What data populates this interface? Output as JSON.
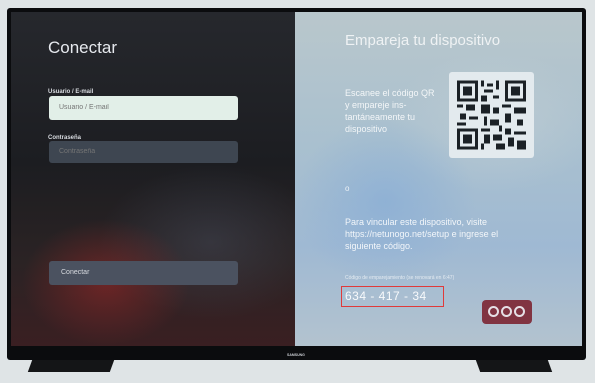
{
  "left": {
    "title": "Conectar",
    "user_label": "Usuario / E-mail",
    "user_placeholder": "Usuario / E-mail",
    "password_label": "Contraseña",
    "password_placeholder": "Contraseña",
    "connect_button": "Conectar"
  },
  "right": {
    "title": "Empareja tu dispositivo",
    "qr_instructions": "Escanee el código QR y empareje ins-tantáneamente tu dispositivo",
    "or": "o",
    "link_instructions": "Para vincular este dispositivo, visite https://netunogo.net/setup e ingrese el siguiente código.",
    "code_label": "Código de emparejamiento (se renovará en 6:47)",
    "code": "634 - 417 - 34"
  },
  "tv": {
    "brand": "SAMSUNG"
  },
  "colors": {
    "highlight": "#e03a3a",
    "input_active": "#e2efe8",
    "button_bg": "#4b5260"
  }
}
